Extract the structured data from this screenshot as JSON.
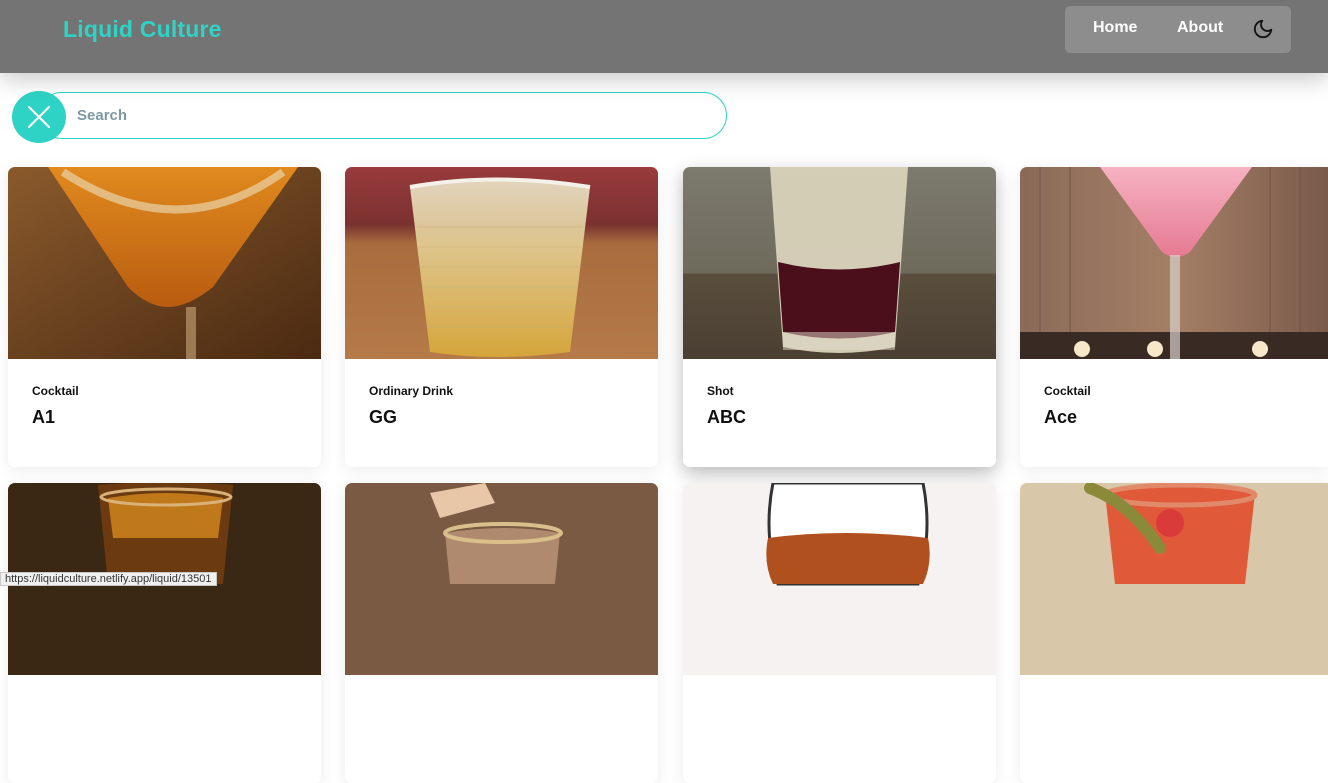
{
  "header": {
    "brand": "Liquid Culture",
    "nav": [
      {
        "label": "Home"
      },
      {
        "label": "About"
      }
    ],
    "theme_toggle_icon": "moon-icon"
  },
  "search": {
    "placeholder": "Search",
    "value": "",
    "clear_icon": "close-icon"
  },
  "drinks": [
    {
      "category": "Cocktail",
      "name": "A1"
    },
    {
      "category": "Ordinary Drink",
      "name": "GG"
    },
    {
      "category": "Shot",
      "name": "ABC"
    },
    {
      "category": "Cocktail",
      "name": "Ace"
    }
  ],
  "status_bar": {
    "url": "https://liquidculture.netlify.app/liquid/13501"
  },
  "colors": {
    "accent": "#2fd3c5",
    "navbar": "#747474",
    "nav_group": "#8d8d8d"
  }
}
